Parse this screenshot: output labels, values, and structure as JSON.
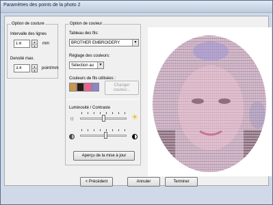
{
  "window": {
    "title": "Paramètres des points de la photo 2"
  },
  "sewing_option": {
    "group_title": "Option de couture",
    "line_interval_label": "Intervalle des lignes",
    "line_interval_value": "1.6",
    "line_interval_unit": "mm",
    "max_density_label": "Densité max.",
    "max_density_value": "3.4",
    "max_density_unit": "point/mm"
  },
  "color_option": {
    "group_title": "Option de couleur",
    "thread_table_label": "Tableau des fils:",
    "thread_table_value": "BROTHER EMBROIDERY",
    "color_adjust_label": "Réglage des couleurs:",
    "color_adjust_value": "Sélection au",
    "used_colors_label": "Couleurs de fils utilisées :",
    "used_colors": [
      "#c8964f",
      "#2b1b12",
      "#ef5f90",
      "#8c86c9"
    ],
    "change_color_button": [
      "Changer",
      "couleur..."
    ]
  },
  "brightness_contrast": {
    "label": "Luminosité / Contraste",
    "brightness_level": 0.5,
    "contrast_level": 0.55,
    "brightness_low_icon": "sun-small-icon",
    "brightness_high_icon": "sun-bright-icon",
    "contrast_low_icon": "contrast-low-icon",
    "contrast_high_icon": "contrast-high-icon"
  },
  "update_preview_button": "Aperçu de la mise à jour",
  "footer": {
    "back_button": "< Précédent",
    "cancel_button": "Annuler",
    "finish_button": "Terminer"
  },
  "preview": {
    "thread_colors": [
      "#b07e8f",
      "#d790a6",
      "#8f8fbf",
      "#3a2a26",
      "#c7a06f"
    ]
  }
}
